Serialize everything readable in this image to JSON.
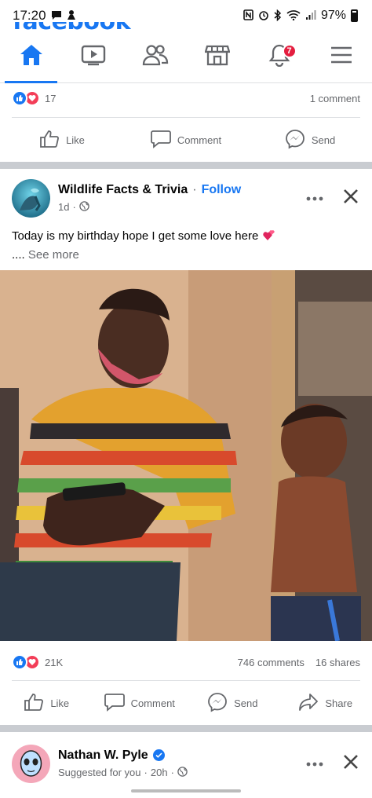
{
  "status_bar": {
    "time": "17:20",
    "battery": "97%"
  },
  "brand": {
    "logo": "facebook",
    "accent": "#1877f2",
    "love": "#f33e58"
  },
  "nav": {
    "tabs": [
      {
        "icon": "home-icon",
        "active": true
      },
      {
        "icon": "watch-video-icon"
      },
      {
        "icon": "friends-icon"
      },
      {
        "icon": "marketplace-icon"
      },
      {
        "icon": "notifications-bell-icon",
        "badge": "7"
      },
      {
        "icon": "menu-icon"
      }
    ]
  },
  "prev_post": {
    "reaction_count": "17",
    "comments": "1 comment",
    "actions": {
      "like": "Like",
      "comment": "Comment",
      "send": "Send"
    }
  },
  "post": {
    "page_name": "Wildlife Facts & Trivia",
    "separator": "·",
    "follow": "Follow",
    "time": "1d",
    "text": "Today is my birthday hope I get some love here",
    "see_more_prefix": "....",
    "see_more": "See more",
    "reaction_count": "21K",
    "comments": "746 comments",
    "shares": "16 shares",
    "actions": {
      "like": "Like",
      "comment": "Comment",
      "send": "Send",
      "share": "Share"
    }
  },
  "next_post": {
    "name": "Nathan W. Pyle",
    "subtitle": "Suggested for you",
    "separator": "·",
    "time": "20h"
  }
}
